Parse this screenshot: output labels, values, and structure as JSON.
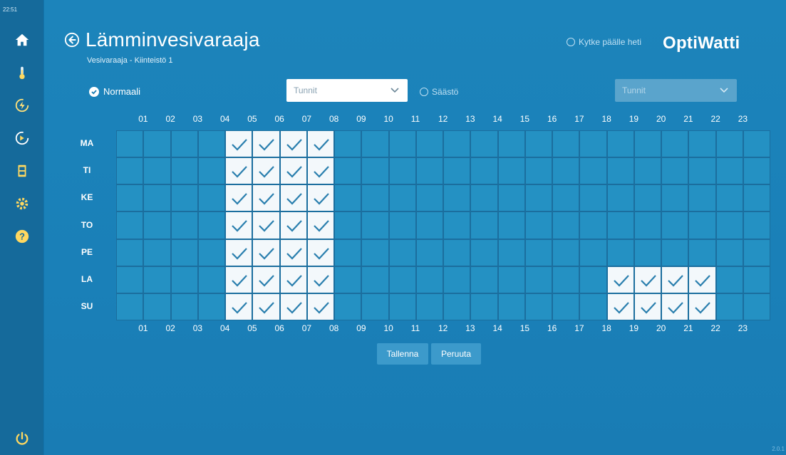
{
  "clock": "22:51",
  "title": "Lämminvesivaraaja",
  "subtitle": "Vesivaraaja - Kiinteistö 1",
  "switch_now_label": "Kytke päälle heti",
  "logo": "OptiWatti",
  "mode_normal_label": "Normaali",
  "mode_saasto_label": "Säästö",
  "select_normal": "Tunnit",
  "select_saasto": "Tunnit",
  "hours": [
    "01",
    "02",
    "03",
    "04",
    "05",
    "06",
    "07",
    "08",
    "09",
    "10",
    "11",
    "12",
    "13",
    "14",
    "15",
    "16",
    "17",
    "18",
    "19",
    "20",
    "21",
    "22",
    "23"
  ],
  "days": [
    "MA",
    "TI",
    "KE",
    "TO",
    "PE",
    "LA",
    "SU"
  ],
  "schedule": [
    [
      5,
      6,
      7,
      8
    ],
    [
      5,
      6,
      7,
      8
    ],
    [
      5,
      6,
      7,
      8
    ],
    [
      5,
      6,
      7,
      8
    ],
    [
      5,
      6,
      7,
      8
    ],
    [
      5,
      6,
      7,
      8,
      19,
      20,
      21,
      22
    ],
    [
      5,
      6,
      7,
      8,
      19,
      20,
      21,
      22
    ]
  ],
  "buttons": {
    "save": "Tallenna",
    "cancel": "Peruuta"
  },
  "version": "2.0.1",
  "sidebar_icons": [
    "home-icon",
    "thermometer-icon",
    "energy-icon",
    "savings-icon",
    "storage-icon",
    "settings-icon",
    "help-icon",
    "power-icon"
  ],
  "colors": {
    "background": "#1a7db3",
    "sidebar": "#156a9b",
    "cell": "#2491c3",
    "cell_on": "#f3f8fb",
    "check": "#2a7fae"
  }
}
